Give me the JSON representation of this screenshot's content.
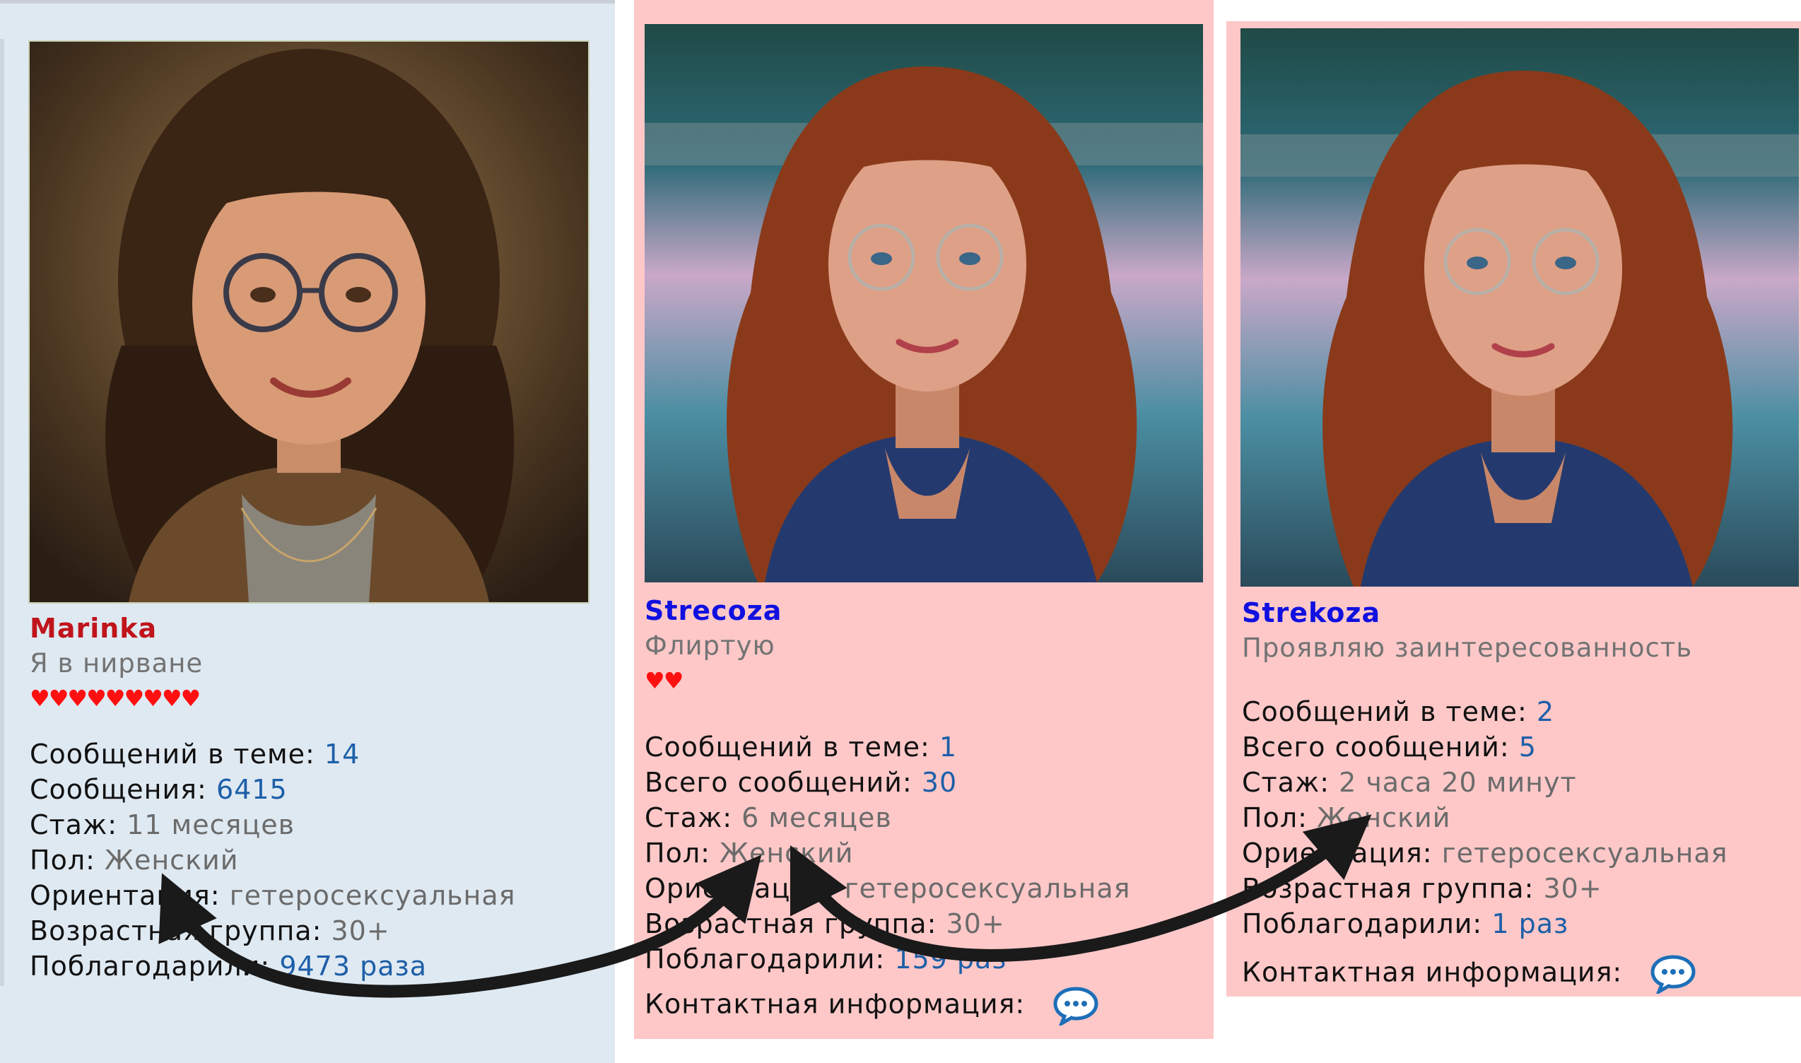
{
  "cards": [
    {
      "username": "Marinka",
      "status": "Я в нирване",
      "hearts": "♥♥♥♥♥♥♥♥♥",
      "stats": [
        {
          "label": "Сообщений в теме:",
          "value": "14"
        },
        {
          "label": "Сообщения:",
          "value": "6415"
        },
        {
          "label": "Стаж:",
          "value": "11 месяцев"
        },
        {
          "label": "Пол:",
          "value": "Женский"
        },
        {
          "label": "Ориентация:",
          "value": "гетеросексуальная"
        },
        {
          "label": "Возрастная группа:",
          "value": "30+"
        },
        {
          "label": "Поблагодарили:",
          "value": "9473 раза"
        }
      ]
    },
    {
      "username": "Strecoza",
      "status": "Флиртую",
      "hearts": "♥♥",
      "stats": [
        {
          "label": "Сообщений в теме:",
          "value": "1"
        },
        {
          "label": "Всего сообщений:",
          "value": "30"
        },
        {
          "label": "Стаж:",
          "value": "6 месяцев"
        },
        {
          "label": "Пол:",
          "value": "Женский"
        },
        {
          "label": "Ориентация:",
          "value": "гетеросексуальная"
        },
        {
          "label": "Возрастная группа:",
          "value": "30+"
        },
        {
          "label": "Поблагодарили:",
          "value": "159 раз"
        }
      ],
      "contact_label": "Контактная информация:"
    },
    {
      "username": "Strekoza",
      "status": "Проявляю заинтересованность",
      "stats": [
        {
          "label": "Сообщений в теме:",
          "value": "2"
        },
        {
          "label": "Всего сообщений:",
          "value": "5"
        },
        {
          "label": "Стаж:",
          "value": "2 часа 20 минут"
        },
        {
          "label": "Пол:",
          "value": "Женский"
        },
        {
          "label": "Ориентация:",
          "value": "гетеросексуальная"
        },
        {
          "label": "Возрастная группа:",
          "value": "30+"
        },
        {
          "label": "Поблагодарили:",
          "value": "1 раз"
        }
      ],
      "contact_label": "Контактная информация:"
    }
  ],
  "colors": {
    "card1_bg": "#dfe9f2",
    "card_pink_bg": "#fec8c8",
    "username_red": "#c0141c",
    "username_blue": "#1010e0",
    "value_link": "#1d5fa8",
    "heart": "#ff1010",
    "arrow": "#1a1a1a"
  },
  "icons": {
    "contact": "speech-bubble-icon",
    "heart": "heart-icon",
    "arrow": "curved-arrow"
  }
}
